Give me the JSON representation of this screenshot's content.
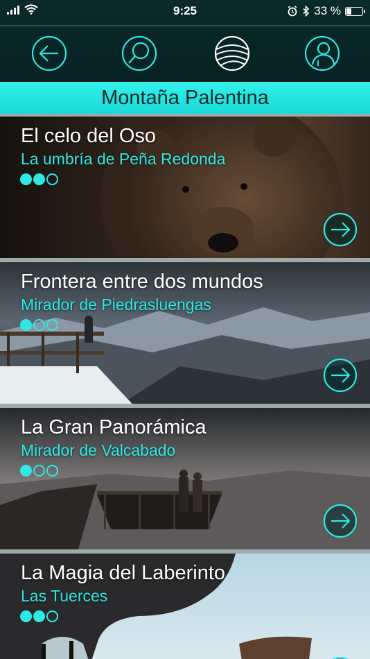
{
  "status_bar": {
    "time": "9:25",
    "battery": "33 %",
    "battery_fraction": 0.33,
    "icons": [
      "signal-icon",
      "wifi-icon",
      "alarm-icon",
      "bluetooth-icon",
      "battery-icon"
    ]
  },
  "nav": {
    "items": [
      {
        "name": "back-arrow-icon"
      },
      {
        "name": "search-icon"
      },
      {
        "name": "globe-icon"
      },
      {
        "name": "user-icon"
      }
    ],
    "accent": "#2ee8e4"
  },
  "region": {
    "title": "Montaña Palentina"
  },
  "routes": [
    {
      "title": "El celo del Oso",
      "subtitle": "La umbría de Peña Redonda",
      "difficulty": 2,
      "max": 3
    },
    {
      "title": "Frontera entre dos mundos",
      "subtitle": "Mirador de Piedrasluengas",
      "difficulty": 1,
      "max": 3
    },
    {
      "title": "La Gran Panorámica",
      "subtitle": "Mirador de Valcabado",
      "difficulty": 1,
      "max": 3
    },
    {
      "title": "La Magia del Laberinto",
      "subtitle": "Las Tuerces",
      "difficulty": 2,
      "max": 3
    }
  ]
}
